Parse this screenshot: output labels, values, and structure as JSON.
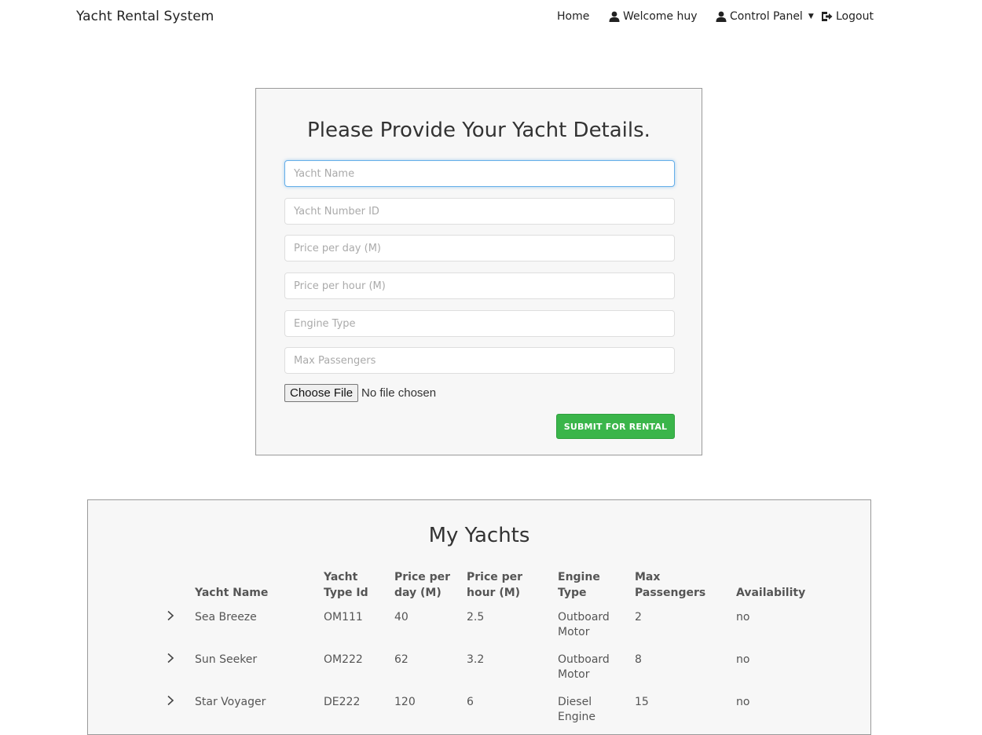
{
  "navbar": {
    "brand": "Yacht Rental System",
    "home": "Home",
    "welcome": "Welcome huy",
    "control_panel": "Control Panel",
    "logout": "Logout"
  },
  "form": {
    "title": "Please Provide Your Yacht Details.",
    "placeholders": {
      "yacht_name": "Yacht Name",
      "yacht_number_id": "Yacht Number ID",
      "price_per_day": "Price per day (M)",
      "price_per_hour": "Price per hour (M)",
      "engine_type": "Engine Type",
      "max_passengers": "Max Passengers"
    },
    "file_button": "Choose File",
    "file_status": "No file chosen",
    "submit_label": "SUBMIT FOR RENTAL"
  },
  "yachts": {
    "title": "My Yachts",
    "columns": {
      "name": "Yacht Name",
      "type_id": "Yacht Type Id",
      "price_day": "Price per day (M)",
      "price_hour": "Price per hour (M)",
      "engine": "Engine Type",
      "max": "Max Passengers",
      "availability": "Availability"
    },
    "rows": [
      {
        "name": "Sea Breeze",
        "type_id": "OM111",
        "price_day": "40",
        "price_hour": "2.5",
        "engine": "Outboard Motor",
        "max": "2",
        "availability": "no"
      },
      {
        "name": "Sun Seeker",
        "type_id": "OM222",
        "price_day": "62",
        "price_hour": "3.2",
        "engine": "Outboard Motor",
        "max": "8",
        "availability": "no"
      },
      {
        "name": "Star Voyager",
        "type_id": "DE222",
        "price_day": "120",
        "price_hour": "6",
        "engine": "Diesel Engine",
        "max": "15",
        "availability": "no"
      }
    ]
  },
  "colors": {
    "submit": "#3ab54a",
    "focus_border": "#66afe9",
    "panel_bg": "#f7f7f7"
  },
  "icons": [
    "user-icon",
    "user-icon",
    "logout-icon",
    "chevron-right-icon"
  ]
}
